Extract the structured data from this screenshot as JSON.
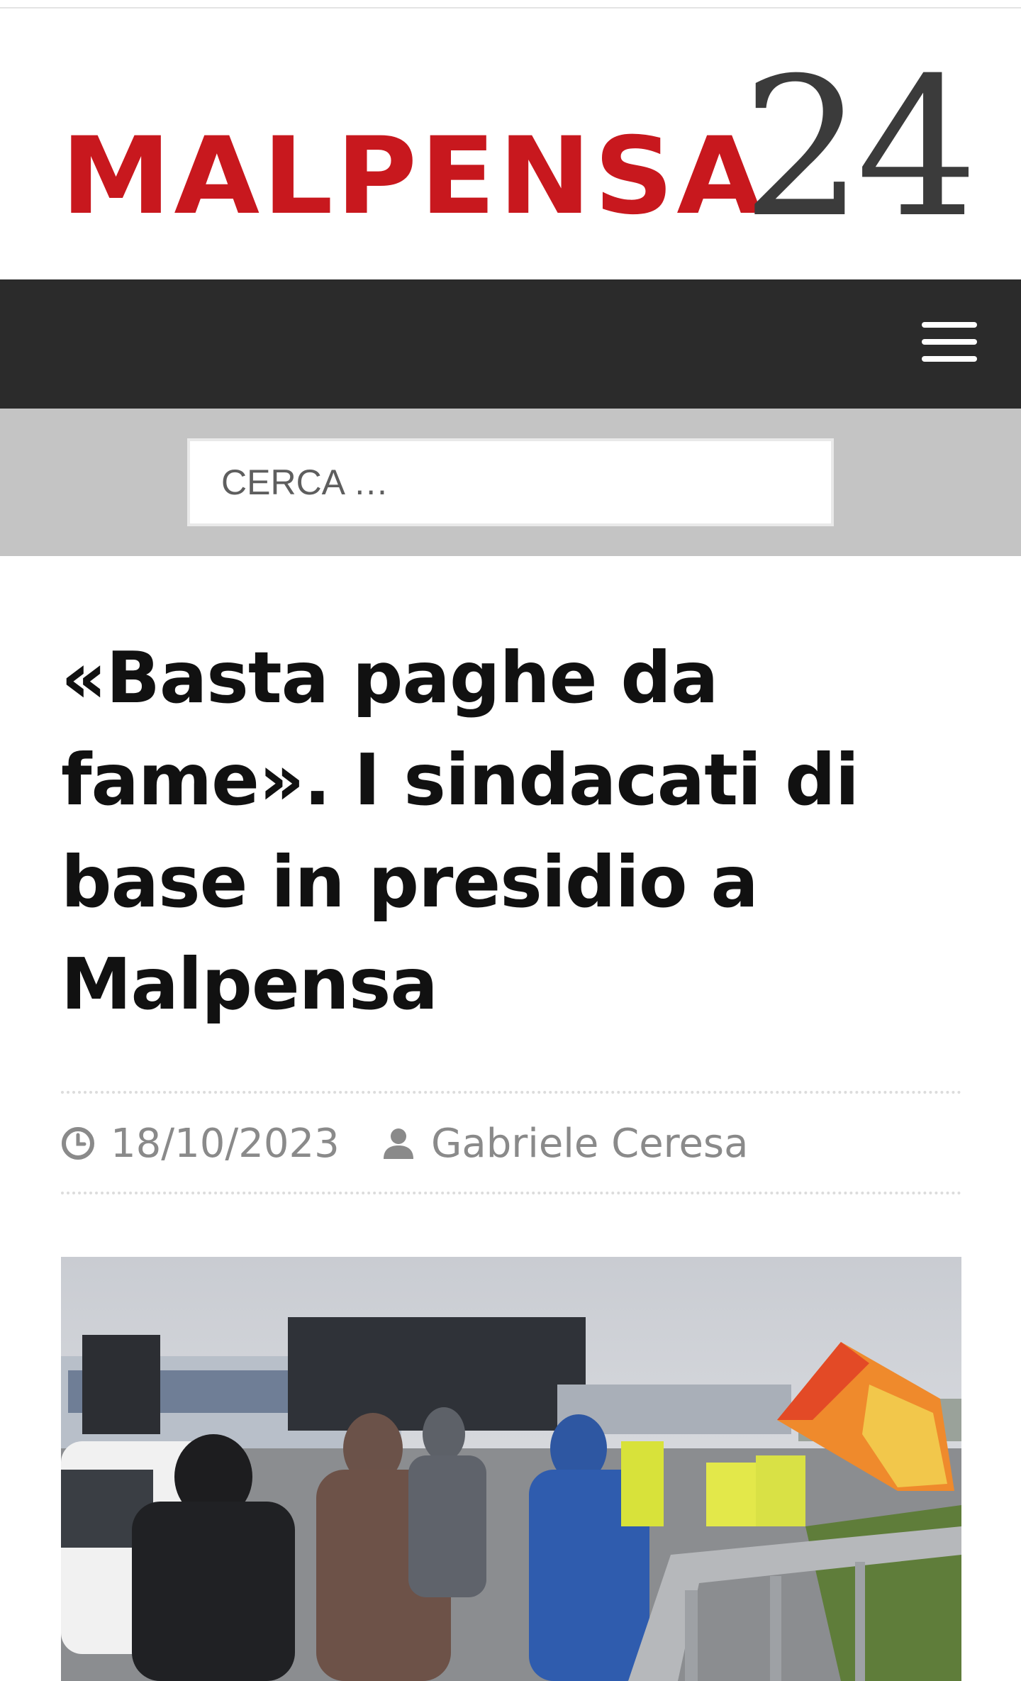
{
  "header": {
    "logo_word": "MALPENSA",
    "logo_number": "24"
  },
  "nav": {
    "menu_icon": "hamburger-menu-icon"
  },
  "search": {
    "placeholder": "CERCA …"
  },
  "article": {
    "title": "«Basta paghe da fame». I sindacati di base in presidio a Malpensa",
    "date": "18/10/2023",
    "author": "Gabriele Ceresa",
    "date_icon": "clock-icon",
    "author_icon": "user-icon"
  },
  "colors": {
    "brand_red": "#c8181e",
    "logo_gray": "#3b3b3b",
    "navbar": "#2b2b2b",
    "searchbar": "#c4c4c4"
  }
}
